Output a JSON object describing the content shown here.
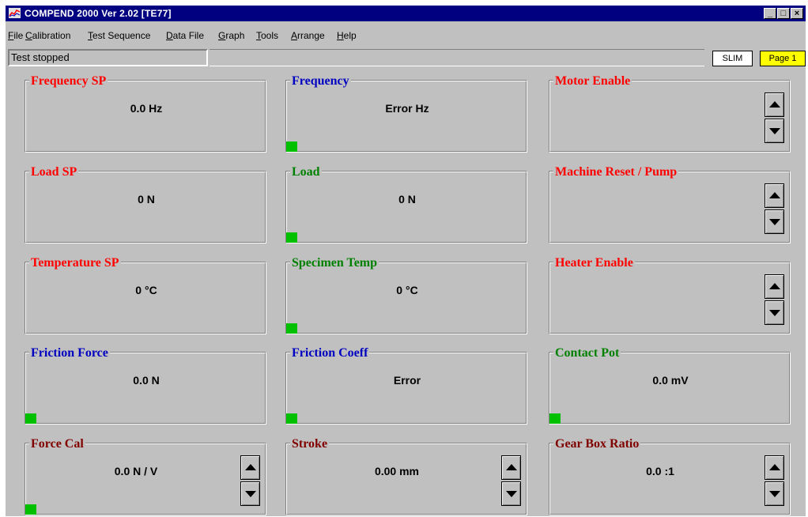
{
  "window": {
    "title": "COMPEND 2000 Ver 2.02  [TE77]",
    "minimize_glyph": "_",
    "maximize_glyph": "□",
    "close_glyph": "×",
    "title_bar_color": "#000080"
  },
  "menu": {
    "items": [
      "File",
      "Calibration",
      "Test Sequence",
      "Data File",
      "Graph",
      "Tools",
      "Arrange",
      "Help"
    ]
  },
  "status": {
    "text": "Test stopped",
    "slim_label": "SLIM",
    "page_label": "Page 1"
  },
  "colors": {
    "red": "#ff0000",
    "blue": "#0000c0",
    "green": "#008000",
    "maroon": "#800000",
    "indicator": "#00c000",
    "page_badge": "#ffff00"
  },
  "panels": [
    {
      "title": "Frequency SP",
      "title_color": "red",
      "value": "0.0 Hz",
      "indicator": false,
      "spinner": false
    },
    {
      "title": "Frequency",
      "title_color": "blue",
      "value": "Error Hz",
      "indicator": true,
      "spinner": false
    },
    {
      "title": "Motor Enable",
      "title_color": "red",
      "value": "",
      "indicator": false,
      "spinner": true
    },
    {
      "title": "Load SP",
      "title_color": "red",
      "value": "0 N",
      "indicator": false,
      "spinner": false
    },
    {
      "title": "Load",
      "title_color": "green",
      "value": "0 N",
      "indicator": true,
      "spinner": false
    },
    {
      "title": "Machine Reset / Pump",
      "title_color": "red",
      "value": "",
      "indicator": false,
      "spinner": true
    },
    {
      "title": "Temperature SP",
      "title_color": "red",
      "value": "0 °C",
      "indicator": false,
      "spinner": false
    },
    {
      "title": "Specimen Temp",
      "title_color": "green",
      "value": "0 °C",
      "indicator": true,
      "spinner": false
    },
    {
      "title": "Heater Enable",
      "title_color": "red",
      "value": "",
      "indicator": false,
      "spinner": true
    },
    {
      "title": "Friction Force",
      "title_color": "blue",
      "value": "0.0 N",
      "indicator": true,
      "spinner": false
    },
    {
      "title": "Friction Coeff",
      "title_color": "blue",
      "value": "Error",
      "indicator": true,
      "spinner": false
    },
    {
      "title": "Contact Pot",
      "title_color": "green",
      "value": "0.0 mV",
      "indicator": true,
      "spinner": false
    },
    {
      "title": "Force Cal",
      "title_color": "maroon",
      "value": "0.0 N / V",
      "indicator": true,
      "spinner": true
    },
    {
      "title": "Stroke",
      "title_color": "maroon",
      "value": "0.00 mm",
      "indicator": false,
      "spinner": true
    },
    {
      "title": "Gear Box Ratio",
      "title_color": "maroon",
      "value": "0.0 :1",
      "indicator": false,
      "spinner": true
    }
  ]
}
